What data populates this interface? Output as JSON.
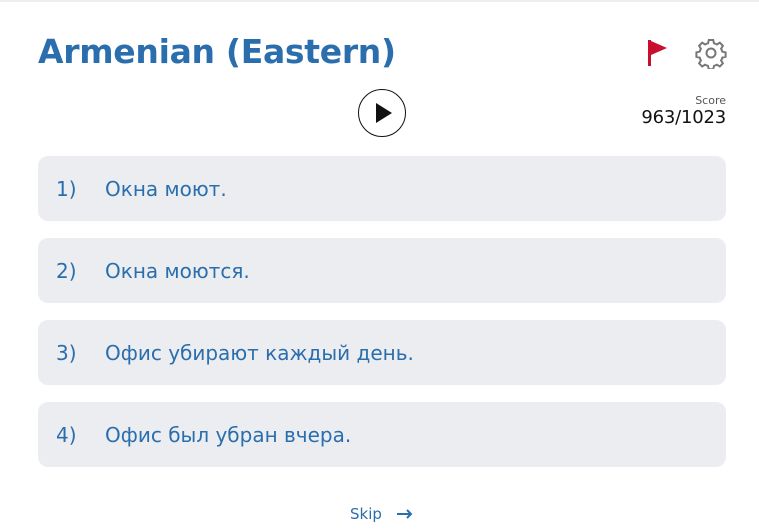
{
  "header": {
    "title": "Armenian (Eastern)"
  },
  "score": {
    "label": "Score",
    "value": "963/1023"
  },
  "icons": {
    "flag": "flag-icon",
    "settings": "gear-icon",
    "play": "play-icon",
    "skip": "arrow-right-icon"
  },
  "options": [
    {
      "number": "1)",
      "text": "Окна моют."
    },
    {
      "number": "2)",
      "text": "Окна моются."
    },
    {
      "number": "3)",
      "text": "Офис убирают каждый день."
    },
    {
      "number": "4)",
      "text": "Офис был убран вчера."
    }
  ],
  "footer": {
    "skip_label": "Skip"
  },
  "colors": {
    "accent": "#2a6ead",
    "flag": "#c8102e",
    "option_bg": "#ebedf0"
  }
}
